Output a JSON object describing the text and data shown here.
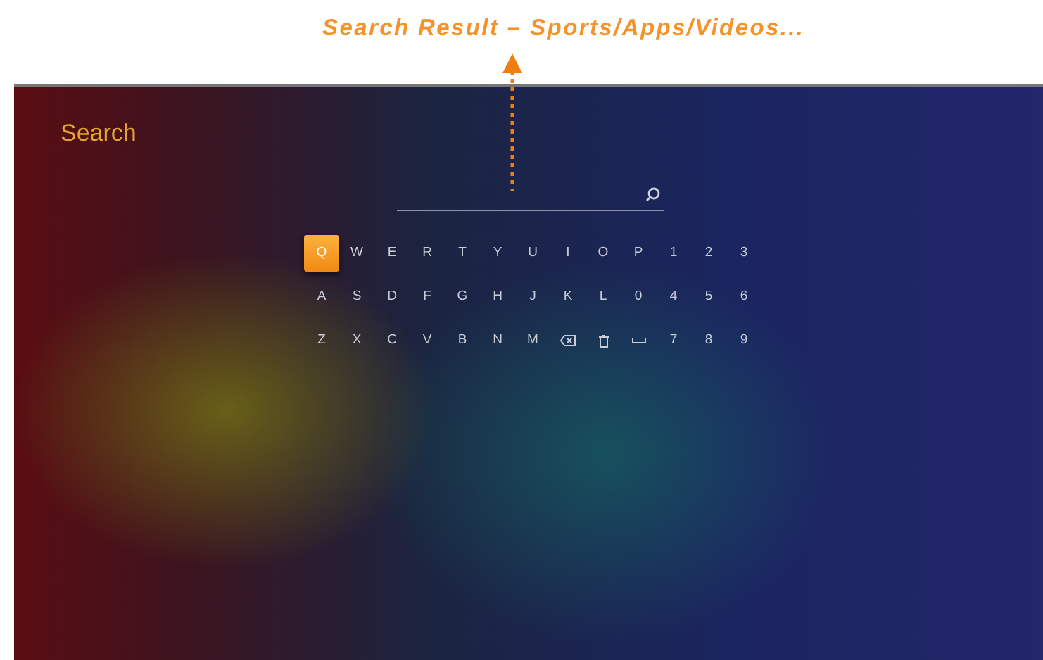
{
  "annotation": {
    "text": "Search Result – Sports/Apps/Videos..."
  },
  "screen": {
    "title": "Search",
    "keyboard": {
      "rows": [
        [
          {
            "kind": "char",
            "label": "Q",
            "selected": true
          },
          {
            "kind": "char",
            "label": "W",
            "selected": false
          },
          {
            "kind": "char",
            "label": "E",
            "selected": false
          },
          {
            "kind": "char",
            "label": "R",
            "selected": false
          },
          {
            "kind": "char",
            "label": "T",
            "selected": false
          },
          {
            "kind": "char",
            "label": "Y",
            "selected": false
          },
          {
            "kind": "char",
            "label": "U",
            "selected": false
          },
          {
            "kind": "char",
            "label": "I",
            "selected": false
          },
          {
            "kind": "char",
            "label": "O",
            "selected": false
          },
          {
            "kind": "char",
            "label": "P",
            "selected": false
          },
          {
            "kind": "char",
            "label": "1",
            "selected": false
          },
          {
            "kind": "char",
            "label": "2",
            "selected": false
          },
          {
            "kind": "char",
            "label": "3",
            "selected": false
          }
        ],
        [
          {
            "kind": "char",
            "label": "A",
            "selected": false
          },
          {
            "kind": "char",
            "label": "S",
            "selected": false
          },
          {
            "kind": "char",
            "label": "D",
            "selected": false
          },
          {
            "kind": "char",
            "label": "F",
            "selected": false
          },
          {
            "kind": "char",
            "label": "G",
            "selected": false
          },
          {
            "kind": "char",
            "label": "H",
            "selected": false
          },
          {
            "kind": "char",
            "label": "J",
            "selected": false
          },
          {
            "kind": "char",
            "label": "K",
            "selected": false
          },
          {
            "kind": "char",
            "label": "L",
            "selected": false
          },
          {
            "kind": "char",
            "label": "0",
            "selected": false
          },
          {
            "kind": "char",
            "label": "4",
            "selected": false
          },
          {
            "kind": "char",
            "label": "5",
            "selected": false
          },
          {
            "kind": "char",
            "label": "6",
            "selected": false
          }
        ],
        [
          {
            "kind": "char",
            "label": "Z",
            "selected": false
          },
          {
            "kind": "char",
            "label": "X",
            "selected": false
          },
          {
            "kind": "char",
            "label": "C",
            "selected": false
          },
          {
            "kind": "char",
            "label": "V",
            "selected": false
          },
          {
            "kind": "char",
            "label": "B",
            "selected": false
          },
          {
            "kind": "char",
            "label": "N",
            "selected": false
          },
          {
            "kind": "char",
            "label": "M",
            "selected": false
          },
          {
            "kind": "backspace",
            "selected": false
          },
          {
            "kind": "delete",
            "selected": false
          },
          {
            "kind": "space",
            "selected": false
          },
          {
            "kind": "char",
            "label": "7",
            "selected": false
          },
          {
            "kind": "char",
            "label": "8",
            "selected": false
          },
          {
            "kind": "char",
            "label": "9",
            "selected": false
          }
        ]
      ]
    }
  }
}
